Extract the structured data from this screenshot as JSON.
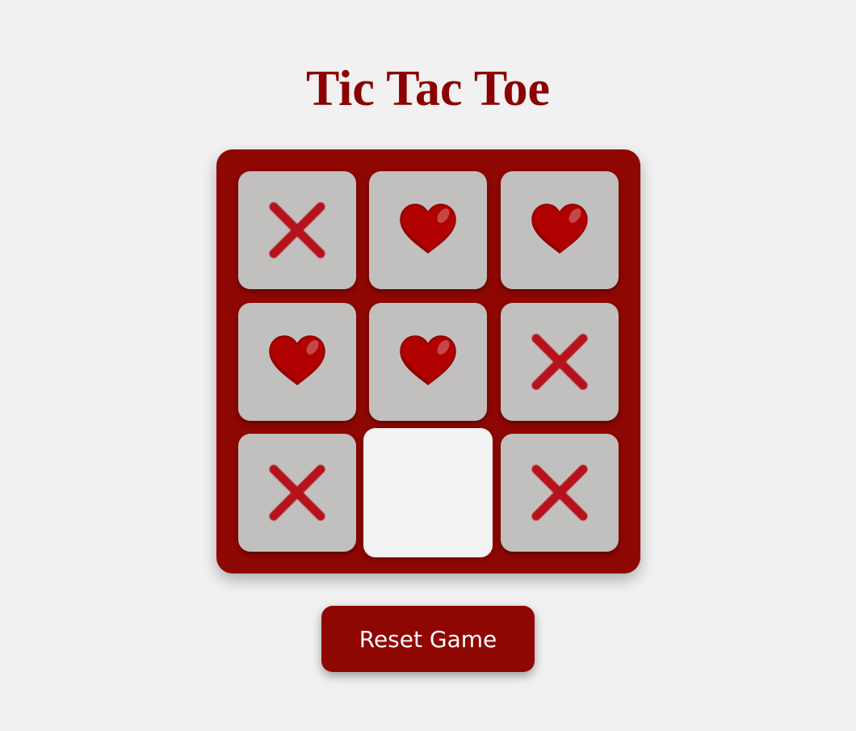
{
  "title": "Tic Tac Toe",
  "reset_label": "Reset Game",
  "colors": {
    "background": "#f1f1f1",
    "board": "#8e0702",
    "cell": "#c2bfbf",
    "empty_cell": "#f2f2f2",
    "x_mark": "#b5121b",
    "heart": "#b00000",
    "title": "#8b0000"
  },
  "board": [
    [
      "X",
      "heart",
      "heart"
    ],
    [
      "heart",
      "heart",
      "X"
    ],
    [
      "X",
      "",
      "X"
    ]
  ]
}
